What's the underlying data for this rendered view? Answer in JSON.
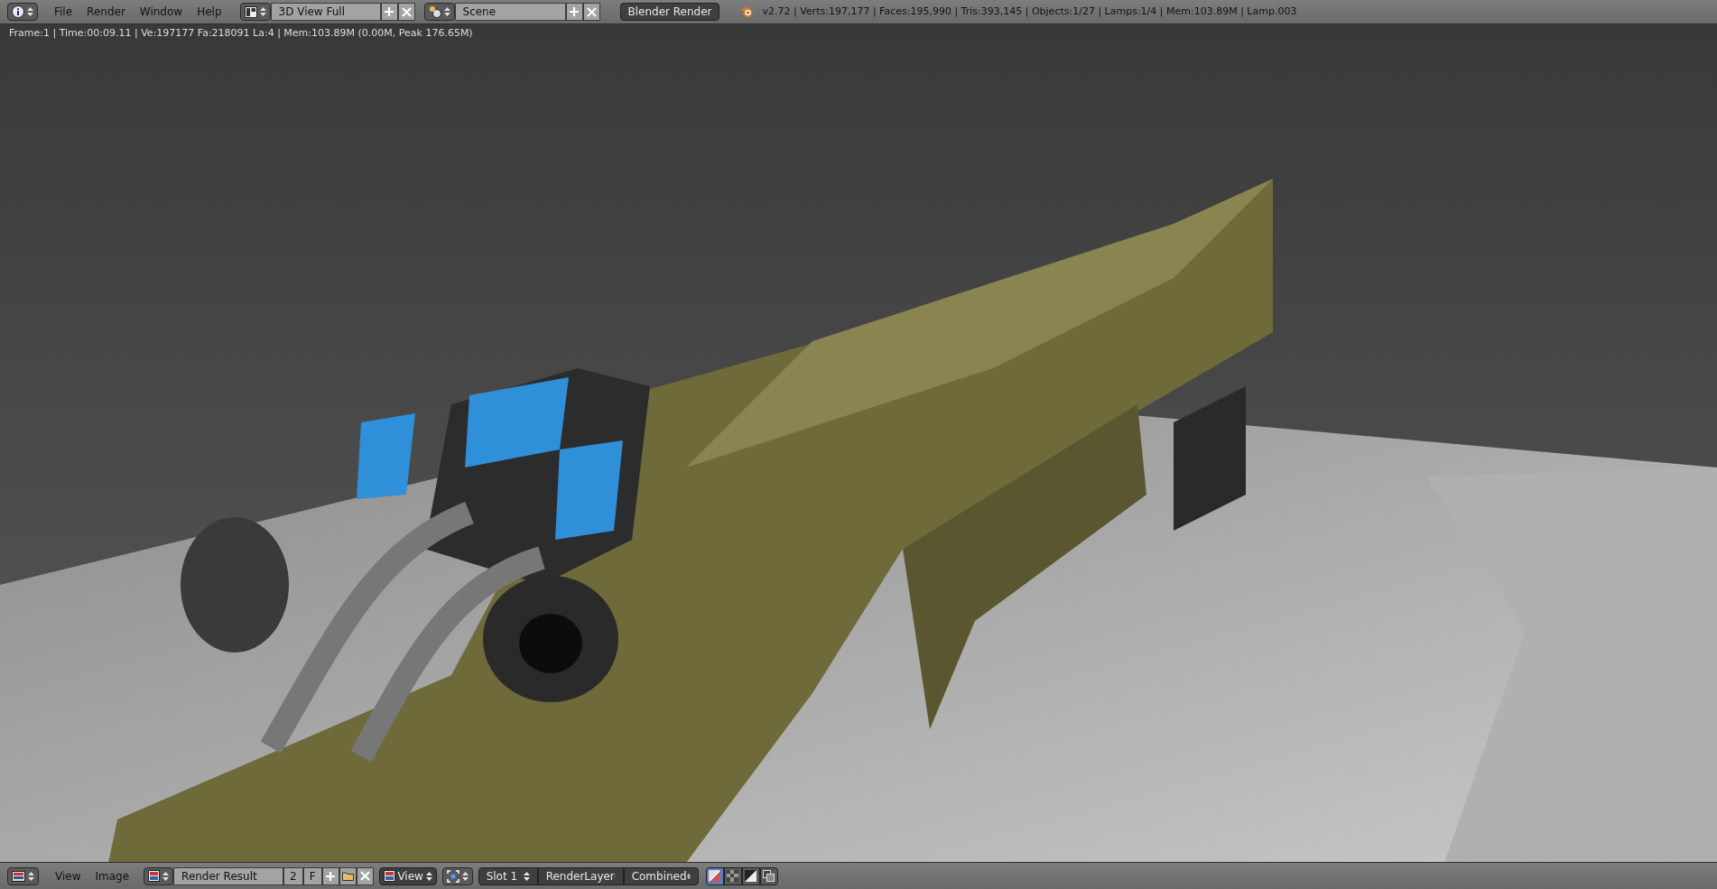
{
  "top_bar": {
    "menus": [
      "File",
      "Render",
      "Window",
      "Help"
    ],
    "screen_layout": "3D View Full",
    "scene": "Scene",
    "render_engine": "Blender Render",
    "stats": "v2.72 | Verts:197,177 | Faces:195,990 | Tris:393,145 | Objects:1/27 | Lamps:1/4 | Mem:103.89M | Lamp.003"
  },
  "render_info": "Frame:1 | Time:00:09.11 | Ve:197177 Fa:218091 La:4 | Mem:103.89M (0.00M, Peak 176.65M)",
  "image_header": {
    "menus": [
      "View",
      "Image"
    ],
    "image_name": "Render Result",
    "users": "2",
    "fake_user": "F",
    "view_menu": "View",
    "slot": "Slot 1",
    "render_layer": "RenderLayer",
    "pass": "Combined",
    "display_buttons": [
      {
        "selected": true
      },
      {
        "selected": false
      },
      {
        "selected": false
      },
      {
        "selected": false
      }
    ]
  }
}
